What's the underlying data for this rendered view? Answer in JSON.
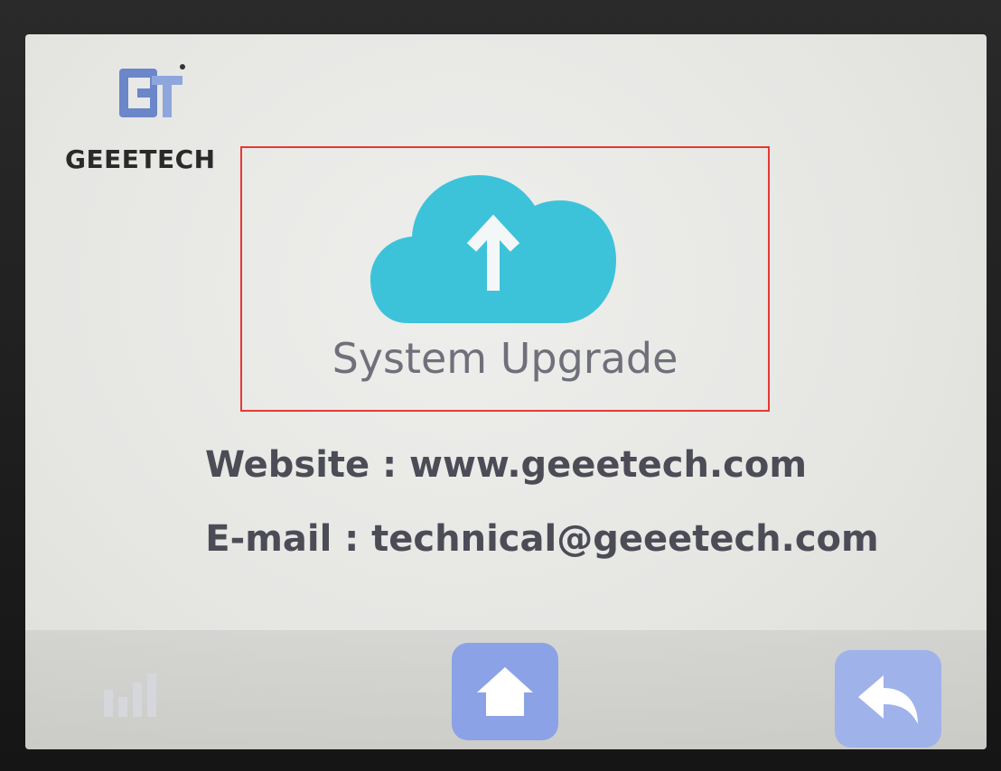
{
  "logo": {
    "text": "GEEETECH"
  },
  "upgrade": {
    "label": "System Upgrade"
  },
  "info": {
    "website": "Website : www.geeetech.com",
    "email": "E-mail : technical@geeetech.com"
  },
  "nav": {
    "stats_icon": "signal-bars-icon",
    "home_icon": "home-icon",
    "back_icon": "back-arrow-icon"
  },
  "colors": {
    "cloud": "#3cc3da",
    "highlight_border": "#e53935",
    "nav_button": "#8ba2e6",
    "text": "#4b4c56"
  }
}
